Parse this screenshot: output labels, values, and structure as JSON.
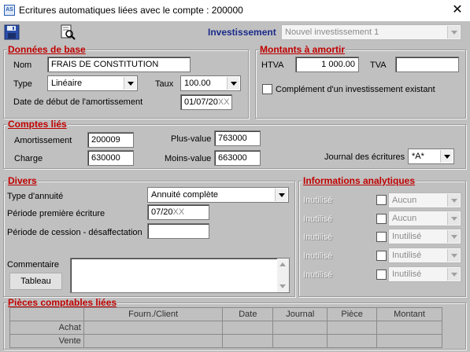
{
  "window": {
    "title": "Ecritures automatiques liées avec le compte : 200000",
    "icon": "app-icon",
    "close": "✕"
  },
  "toolbar": {
    "save_icon": "save-disk-icon",
    "preview_icon": "print-preview-icon",
    "investissement_label": "Investissement",
    "investissement_value": "Nouvel investissement 1"
  },
  "donnees": {
    "title": "Données de base",
    "nom_label": "Nom",
    "nom_value": "FRAIS DE CONSTITUTION",
    "type_label": "Type",
    "type_value": "Linéaire",
    "taux_label": "Taux",
    "taux_value": "100.00",
    "date_label": "Date de début de l'amortissement",
    "date_value": "01/07/20",
    "date_suffix": "XX"
  },
  "montants": {
    "title": "Montants à amortir",
    "htva_label": "HTVA",
    "htva_value": "1 000.00",
    "tva_label": "TVA",
    "tva_value": "",
    "complement_label": "Complément d'un investissement existant",
    "complement_checked": false
  },
  "comptes": {
    "title": "Comptes liés",
    "amort_label": "Amortissement",
    "amort_value": "200009",
    "charge_label": "Charge",
    "charge_value": "630000",
    "plus_label": "Plus-value",
    "plus_value": "763000",
    "moins_label": "Moins-value",
    "moins_value": "663000",
    "journal_label": "Journal des écritures",
    "journal_value": "*A*"
  },
  "divers": {
    "title": "Divers",
    "annuite_label": "Type d'annuité",
    "annuite_value": "Annuité complète",
    "periode1_label": "Période première écriture",
    "periode1_value": "07/20",
    "periode1_suffix": "XX",
    "cession_label": "Période de cession - désaffectation",
    "cession_value": "",
    "commentaire_label": "Commentaire",
    "commentaire_value": "",
    "tableau_button": "Tableau"
  },
  "analytiques": {
    "title": "Informations analytiques",
    "rows": [
      {
        "label": "Inutilisé",
        "value": "Aucun"
      },
      {
        "label": "Inutilisé",
        "value": "Aucun"
      },
      {
        "label": "Inutilisé",
        "value": "Inutilisé"
      },
      {
        "label": "Inutilisé",
        "value": "Inutilisé"
      },
      {
        "label": "Inutilisé",
        "value": "Inutilisé"
      }
    ]
  },
  "pieces": {
    "title": "Pièces comptables liées",
    "columns": [
      "",
      "Fourn./Client",
      "Date",
      "Journal",
      "Pièce",
      "Montant"
    ],
    "rows": [
      "Achat",
      "Vente"
    ]
  },
  "colors": {
    "group_title": "#c00000",
    "investissement": "#1a2a8a",
    "window_bg": "#c0c0c0"
  }
}
